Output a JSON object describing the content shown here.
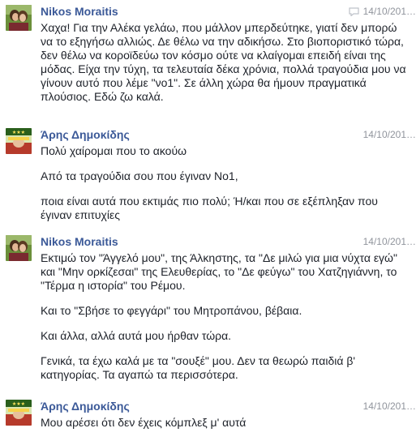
{
  "icons": {
    "reply": "reply-icon"
  },
  "colors": {
    "author": "#3b5998",
    "timestamp": "#90949c",
    "text": "#1d2129"
  },
  "messages": [
    {
      "author": "Nikos Moraitis",
      "timestamp": "14/10/201…",
      "paragraphs": [
        "Χαχα! Για την Αλέκα γελάω, που μάλλον μπερδεύτηκε, γιατί δεν μπορώ να το εξηγήσω αλλιώς. Δε θέλω να την αδικήσω. Στο βιοποριστικό τώρα, δεν θέλω να κοροϊδεύω τον κόσμο ούτε να κλαίγομαι επειδή είναι της μόδας. Είχα την τύχη, τα τελευταία δέκα χρόνια, πολλά τραγούδια μου να γίνουν αυτό που λέμε \"νο1\". Σε άλλη χώρα θα ήμουν πραγματικά πλούσιος. Εδώ ζω καλά."
      ]
    },
    {
      "author": "Άρης Δημοκίδης",
      "timestamp": "14/10/201…",
      "paragraphs": [
        "Πολύ χαίρομαι που το ακούω",
        "Από τα τραγούδια σου που έγιναν Νο1,",
        "ποια είναι αυτά που εκτιμάς πιο πολύ; Ή/και που σε εξέπληξαν που έγιναν επιτυχίες"
      ]
    },
    {
      "author": "Nikos Moraitis",
      "timestamp": "14/10/201…",
      "paragraphs": [
        "Εκτιμώ τον \"Άγγελό μου\", της Άλκηστης, τα \"Δε μιλώ για μια νύχτα εγώ\" και \"Μην ορκίζεσαι\" της Ελευθερίας, το \"Δε φεύγω\" του Χατζηγιάννη, το \"Τέρμα η ιστορία\" του Ρέμου.",
        "Και το \"Σβήσε το φεγγάρι\" του Μητροπάνου, βέβαια.",
        "Και άλλα, αλλά αυτά μου ήρθαν τώρα.",
        "Γενικά, τα έχω καλά με τα \"σουξέ\" μου. Δεν τα θεωρώ παιδιά β' κατηγορίας. Τα αγαπώ τα περισσότερα."
      ]
    },
    {
      "author": "Άρης Δημοκίδης",
      "timestamp": "14/10/201…",
      "paragraphs": [
        "Μου αρέσει ότι δεν έχεις κόμπλεξ μ' αυτά"
      ]
    }
  ]
}
